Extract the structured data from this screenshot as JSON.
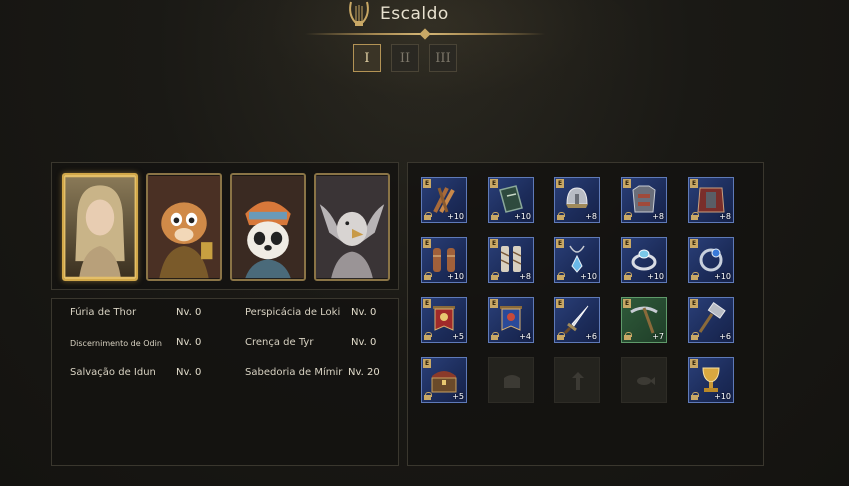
{
  "header": {
    "title": "Escaldo",
    "tabs": [
      {
        "label": "I",
        "active": true
      },
      {
        "label": "II",
        "active": false
      },
      {
        "label": "III",
        "active": false
      }
    ]
  },
  "heroes": [
    {
      "name": "hero-card-blonde-woman",
      "frame": "gold"
    },
    {
      "name": "hero-card-squirrel",
      "frame": "bronze"
    },
    {
      "name": "hero-card-panda",
      "frame": "bronze"
    },
    {
      "name": "hero-card-griffin",
      "frame": "bronze"
    }
  ],
  "stats": [
    {
      "name": "Fúria de Thor",
      "level": "Nv. 0"
    },
    {
      "name": "Perspicácia de Loki",
      "level": "Nv. 0"
    },
    {
      "name": "Discernimento de Odin",
      "level": "Nv. 0"
    },
    {
      "name": "Crença de Tyr",
      "level": "Nv. 0"
    },
    {
      "name": "Salvação de Idun",
      "level": "Nv. 0"
    },
    {
      "name": "Sabedoria de Mímir",
      "level": "Nv. 20"
    }
  ],
  "equipment": {
    "badge_letter": "E",
    "colors": {
      "rare": "#2a3f78",
      "uncommon": "#2f5a3a",
      "badge": "#c9a865"
    },
    "slots": [
      {
        "icon": "weapon-bundle-icon",
        "plus": "+10"
      },
      {
        "icon": "shield-icon",
        "plus": "+10"
      },
      {
        "icon": "helmet-icon",
        "plus": "+8"
      },
      {
        "icon": "chest-armor-icon",
        "plus": "+8"
      },
      {
        "icon": "cloak-armor-icon",
        "plus": "+8"
      },
      {
        "icon": "bracers-icon",
        "plus": "+10"
      },
      {
        "icon": "leg-wraps-icon",
        "plus": "+8"
      },
      {
        "icon": "pendant-icon",
        "plus": "+10"
      },
      {
        "icon": "ring-icon",
        "plus": "+10"
      },
      {
        "icon": "ring-blue-icon",
        "plus": "+10"
      },
      {
        "icon": "red-banner-icon",
        "plus": "+5"
      },
      {
        "icon": "blue-banner-icon",
        "plus": "+4"
      },
      {
        "icon": "dagger-icon",
        "plus": "+6"
      },
      {
        "icon": "pickaxe-icon",
        "plus": "+7"
      },
      {
        "icon": "hammer-icon",
        "plus": "+6"
      },
      {
        "icon": "treasure-chest-icon",
        "plus": "+5"
      },
      {
        "icon": "empty-slot-chest-icon",
        "plus": ""
      },
      {
        "icon": "empty-slot-totem-icon",
        "plus": ""
      },
      {
        "icon": "empty-slot-fish-icon",
        "plus": ""
      },
      {
        "icon": "goblet-icon",
        "plus": "+10"
      }
    ]
  }
}
